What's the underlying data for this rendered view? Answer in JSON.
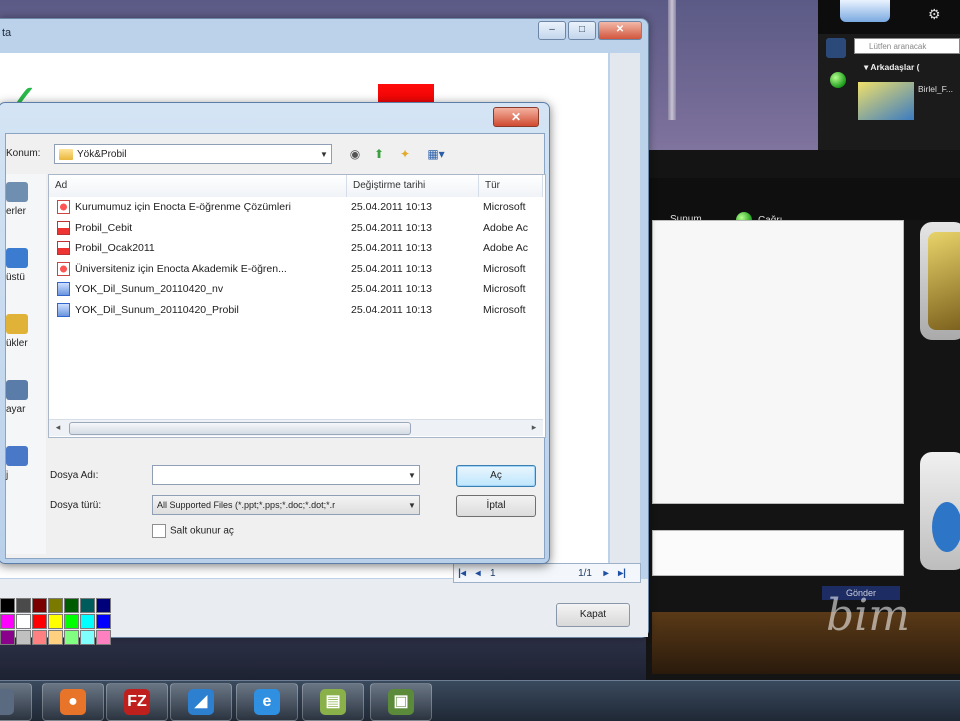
{
  "back_window": {
    "title_fragment": "ta",
    "caption_min": "–",
    "caption_max": "□",
    "caption_close": "✕",
    "pager": {
      "first": "|◂",
      "prev": "◂",
      "page": "1",
      "total": "1/1",
      "next": "▸",
      "last": "▸|"
    },
    "palette_colors": [
      "#000000",
      "#4a4a4a",
      "#7a0000",
      "#7a7a00",
      "#005c00",
      "#005c5c",
      "#00007a",
      "#ff00ff",
      "#ffffff",
      "#ff0000",
      "#ffff00",
      "#00ff00",
      "#00ffff",
      "#0000ff",
      "#8a008a",
      "#c0c0c0",
      "#ff8080",
      "#ffd080",
      "#80ff80",
      "#80ffff",
      "#ff80c0"
    ],
    "close_label": "Kapat"
  },
  "right_app": {
    "menu_item": "Sunum",
    "call_label": "Çağrı",
    "send_label": "Gönder",
    "watermark": "bim"
  },
  "messenger": {
    "search_placeholder": "Lütfen aranacak",
    "group_label": "▾ Arkadaşlar (",
    "friend_name": "Birlel_F..."
  },
  "dialog": {
    "close_label": "✕",
    "look_in_label": "Konum:",
    "look_in_value": "Yök&Probil",
    "columns": {
      "name": "Ad",
      "date": "Değiştirme tarihi",
      "type": "Tür"
    },
    "files": [
      {
        "icon": "ppt",
        "name": "Kurumumuz için Enocta E-öğrenme Çözümleri",
        "date": "25.04.2011 10:13",
        "type": "Microsoft"
      },
      {
        "icon": "pdf",
        "name": "Probil_Cebit",
        "date": "25.04.2011 10:13",
        "type": "Adobe Ac"
      },
      {
        "icon": "pdf",
        "name": "Probil_Ocak2011",
        "date": "25.04.2011 10:13",
        "type": "Adobe Ac"
      },
      {
        "icon": "ppt",
        "name": "Üniversiteniz için Enocta Akademik E-öğren...",
        "date": "25.04.2011 10:13",
        "type": "Microsoft"
      },
      {
        "icon": "vid",
        "name": "YOK_Dil_Sunum_20110420_nv",
        "date": "25.04.2011 10:13",
        "type": "Microsoft"
      },
      {
        "icon": "vid",
        "name": "YOK_Dil_Sunum_20110420_Probil",
        "date": "25.04.2011 10:13",
        "type": "Microsoft"
      }
    ],
    "places": [
      {
        "label": "erler",
        "color": "#6f8fb0"
      },
      {
        "label": "üstü",
        "color": "#3b7bd0"
      },
      {
        "label": "ükler",
        "color": "#e0b238"
      },
      {
        "label": "ayar",
        "color": "#5a7ca8"
      },
      {
        "label": "j",
        "color": "#4a78c8"
      }
    ],
    "filename_label": "Dosya Adı:",
    "filename_value": "",
    "filetype_label": "Dosya türü:",
    "filetype_value": "All Supported Files (*.ppt;*.pps;*.doc;*.dot;*.r",
    "readonly_label": "Salt okunur aç",
    "open_label": "Aç",
    "cancel_label": "İptal"
  },
  "taskbar": {
    "items": [
      {
        "name": "taskbar-app-partial",
        "glyph": "",
        "color": "#5a6a80"
      },
      {
        "name": "taskbar-firefox",
        "glyph": "●",
        "color": "#e8742a"
      },
      {
        "name": "taskbar-filezilla",
        "glyph": "FZ",
        "color": "#c0201d"
      },
      {
        "name": "taskbar-active-app",
        "glyph": "◢",
        "color": "#2d7fd0"
      },
      {
        "name": "taskbar-ie",
        "glyph": "e",
        "color": "#2f8fe0"
      },
      {
        "name": "taskbar-notes",
        "glyph": "▤",
        "color": "#8ab04a"
      },
      {
        "name": "taskbar-media",
        "glyph": "▣",
        "color": "#5b8a3a"
      }
    ]
  }
}
